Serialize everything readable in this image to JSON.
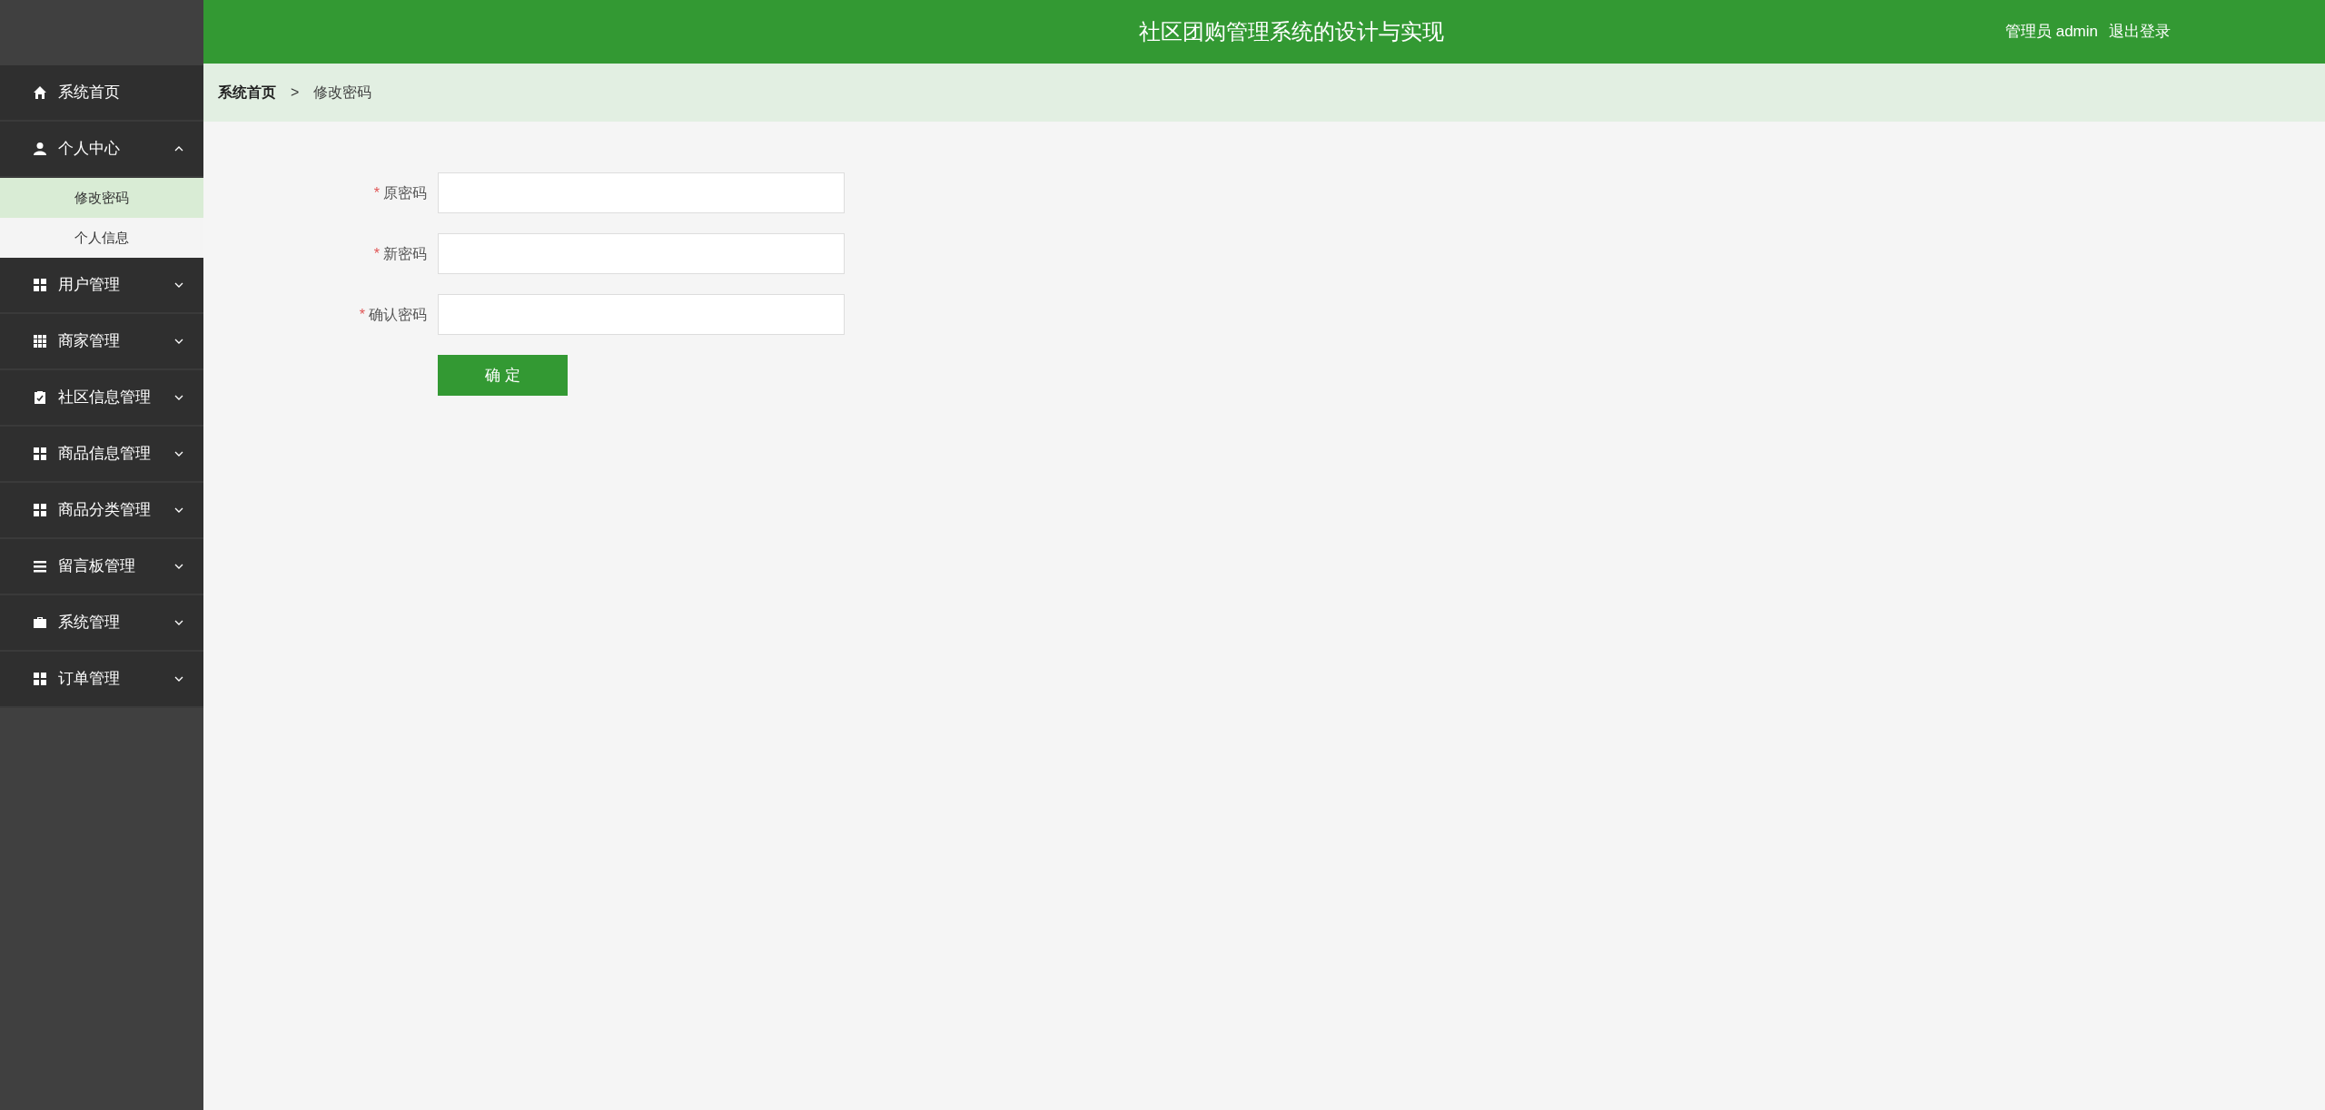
{
  "header": {
    "title": "社区团购管理系统的设计与实现",
    "user_label": "管理员 admin",
    "logout": "退出登录"
  },
  "sidebar": {
    "items": [
      {
        "label": "系统首页"
      },
      {
        "label": "个人中心",
        "expanded": true,
        "children": [
          {
            "label": "修改密码",
            "selected": true
          },
          {
            "label": "个人信息",
            "selected": false
          }
        ]
      },
      {
        "label": "用户管理",
        "expanded": false
      },
      {
        "label": "商家管理",
        "expanded": false
      },
      {
        "label": "社区信息管理",
        "expanded": false
      },
      {
        "label": "商品信息管理",
        "expanded": false
      },
      {
        "label": "商品分类管理",
        "expanded": false
      },
      {
        "label": "留言板管理",
        "expanded": false
      },
      {
        "label": "系统管理",
        "expanded": false
      },
      {
        "label": "订单管理",
        "expanded": false
      }
    ]
  },
  "breadcrumb": [
    {
      "label": "系统首页",
      "current": false
    },
    {
      "label": "修改密码",
      "current": true
    }
  ],
  "breadcrumb_separator": ">",
  "form": {
    "fields": [
      {
        "label": "原密码",
        "required_mark": "*"
      },
      {
        "label": "新密码",
        "required_mark": "*"
      },
      {
        "label": "确认密码",
        "required_mark": "*"
      }
    ],
    "submit": "确 定"
  }
}
